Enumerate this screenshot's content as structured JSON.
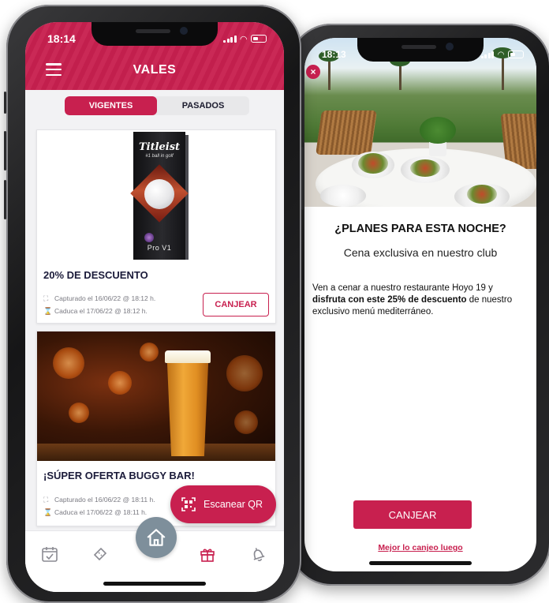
{
  "phone1": {
    "status_time": "18:14",
    "header_title": "VALES",
    "tabs": [
      {
        "label": "VIGENTES",
        "active": true
      },
      {
        "label": "PASADOS",
        "active": false
      }
    ],
    "vouchers": [
      {
        "product_brand": "Titleist",
        "product_tagline": "#1 ball in golf",
        "product_model": "Pro V1",
        "title": "20% DE DESCUENTO",
        "captured": "Capturado el 16/06/22 @ 18:12 h.",
        "expires": "Caduca el 17/06/22 @ 18:12 h.",
        "redeem_label": "CANJEAR"
      },
      {
        "title": "¡SÚPER OFERTA BUGGY BAR!",
        "captured": "Capturado el 16/06/22 @ 18:11 h.",
        "expires": "Caduca el 17/06/22 @ 18:11 h."
      }
    ],
    "scan_label": "Escanear QR",
    "tabbar": [
      "calendar-check-icon",
      "ticket-icon",
      "home-icon",
      "gift-icon",
      "bell-icon"
    ]
  },
  "phone2": {
    "status_time": "18:13",
    "close_label": "×",
    "title": "¿PLANES PARA ESTA NOCHE?",
    "subtitle": "Cena exclusiva en nuestro club",
    "body_pre": "Ven a cenar a nuestro restaurante Hoyo 19 y ",
    "body_bold": "disfruta con este 25% de descuento",
    "body_post": " de nuestro exclusivo menú mediterráneo.",
    "redeem_label": "CANJEAR",
    "later_label": "Mejor lo canjeo luego"
  },
  "colors": {
    "brand": "#c8204f",
    "title_navy": "#1b1b3a",
    "home_button": "#7e8f9b"
  }
}
